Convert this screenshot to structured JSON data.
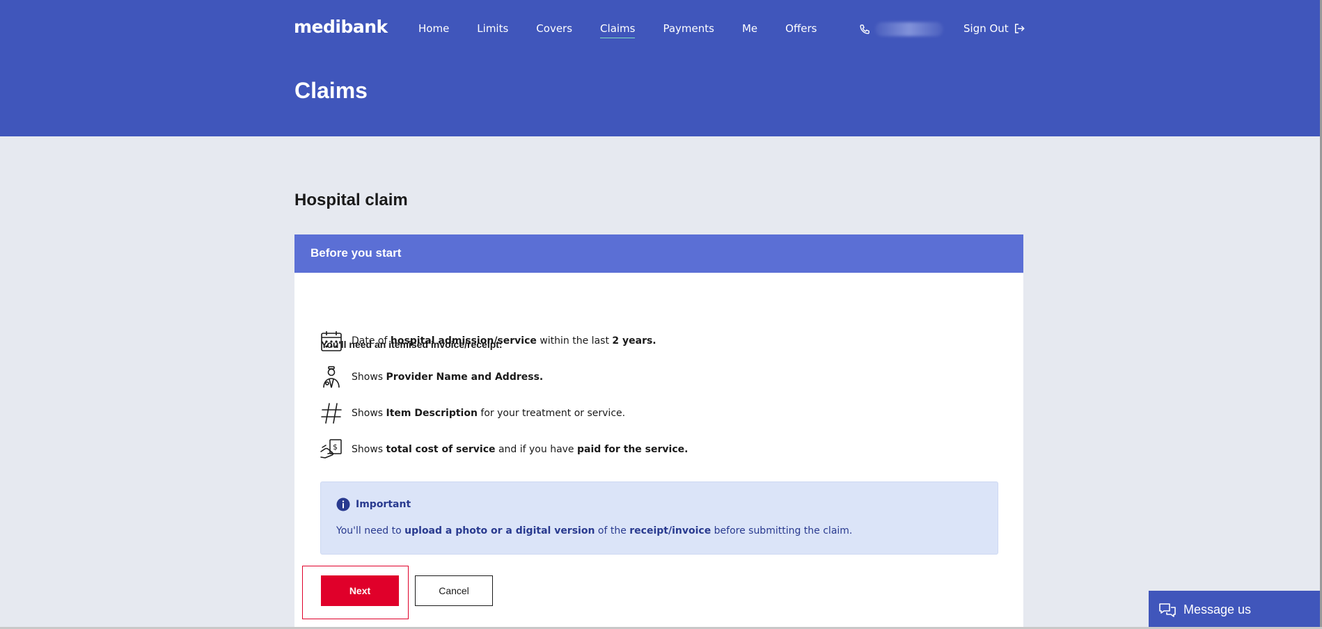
{
  "header": {
    "logo": "medibank",
    "nav": [
      "Home",
      "Limits",
      "Covers",
      "Claims",
      "Payments",
      "Me",
      "Offers"
    ],
    "active_nav": "Claims",
    "sign_out": "Sign Out",
    "page_title": "Claims"
  },
  "main": {
    "section_title": "Hospital claim",
    "card_title": "Before you start",
    "need_heading": "You'll need an itemised invoice/receipt:",
    "requirements": [
      {
        "icon": "calendar-icon",
        "parts": [
          [
            "Date of ",
            false
          ],
          [
            "hospital admission/service",
            true
          ],
          [
            " within the last ",
            false
          ],
          [
            "2 years.",
            true
          ]
        ]
      },
      {
        "icon": "provider-icon",
        "parts": [
          [
            "Shows ",
            false
          ],
          [
            "Provider Name and Address.",
            true
          ]
        ]
      },
      {
        "icon": "hash-icon",
        "parts": [
          [
            "Shows ",
            false
          ],
          [
            "Item Description",
            true
          ],
          [
            " for your treatment or service.",
            false
          ]
        ]
      },
      {
        "icon": "payment-hand-icon",
        "parts": [
          [
            "Shows ",
            false
          ],
          [
            "total cost of service",
            true
          ],
          [
            " and if you have ",
            false
          ],
          [
            "paid for the service.",
            true
          ]
        ]
      }
    ],
    "important": {
      "title": "Important",
      "parts": [
        [
          "You'll need to ",
          false
        ],
        [
          "upload a photo or a digital version",
          true
        ],
        [
          " of the ",
          false
        ],
        [
          "receipt/invoice",
          true
        ],
        [
          " before submitting the claim.",
          false
        ]
      ]
    },
    "next_label": "Next",
    "cancel_label": "Cancel"
  },
  "message_us": "Message us",
  "colors": {
    "header_bg": "#4056bb",
    "card_header_bg": "#5b6fd5",
    "next_button": "#e0002a",
    "important_bg": "#dbe4f8"
  }
}
